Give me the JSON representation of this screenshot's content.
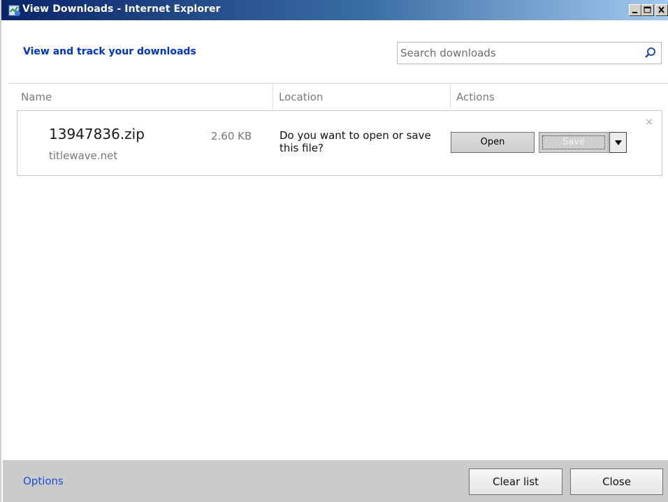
{
  "window": {
    "title": "View Downloads - Internet Explorer"
  },
  "header": {
    "heading": "View and track your downloads",
    "search_placeholder": "Search downloads"
  },
  "columns": {
    "name": "Name",
    "location": "Location",
    "actions": "Actions"
  },
  "download": {
    "filename": "13947836.zip",
    "size": "2.60 KB",
    "source": "titlewave.net",
    "prompt": "Do you want to open or save this file?",
    "open_label": "Open",
    "save_label": "Save",
    "dismiss": "×"
  },
  "footer": {
    "options_label": "Options",
    "clear_label": "Clear list",
    "close_label": "Close"
  },
  "colors": {
    "titlebar_start": "#0a246a",
    "titlebar_end": "#a6caf0",
    "heading_blue": "#0033cc",
    "link_blue": "#1a4fd6",
    "footer_bg": "#cbcbcb"
  },
  "icons": [
    "ie-downloads-icon",
    "minimize-icon",
    "maximize-icon",
    "close-icon",
    "search-icon",
    "dropdown-arrow-icon",
    "dismiss-icon"
  ]
}
